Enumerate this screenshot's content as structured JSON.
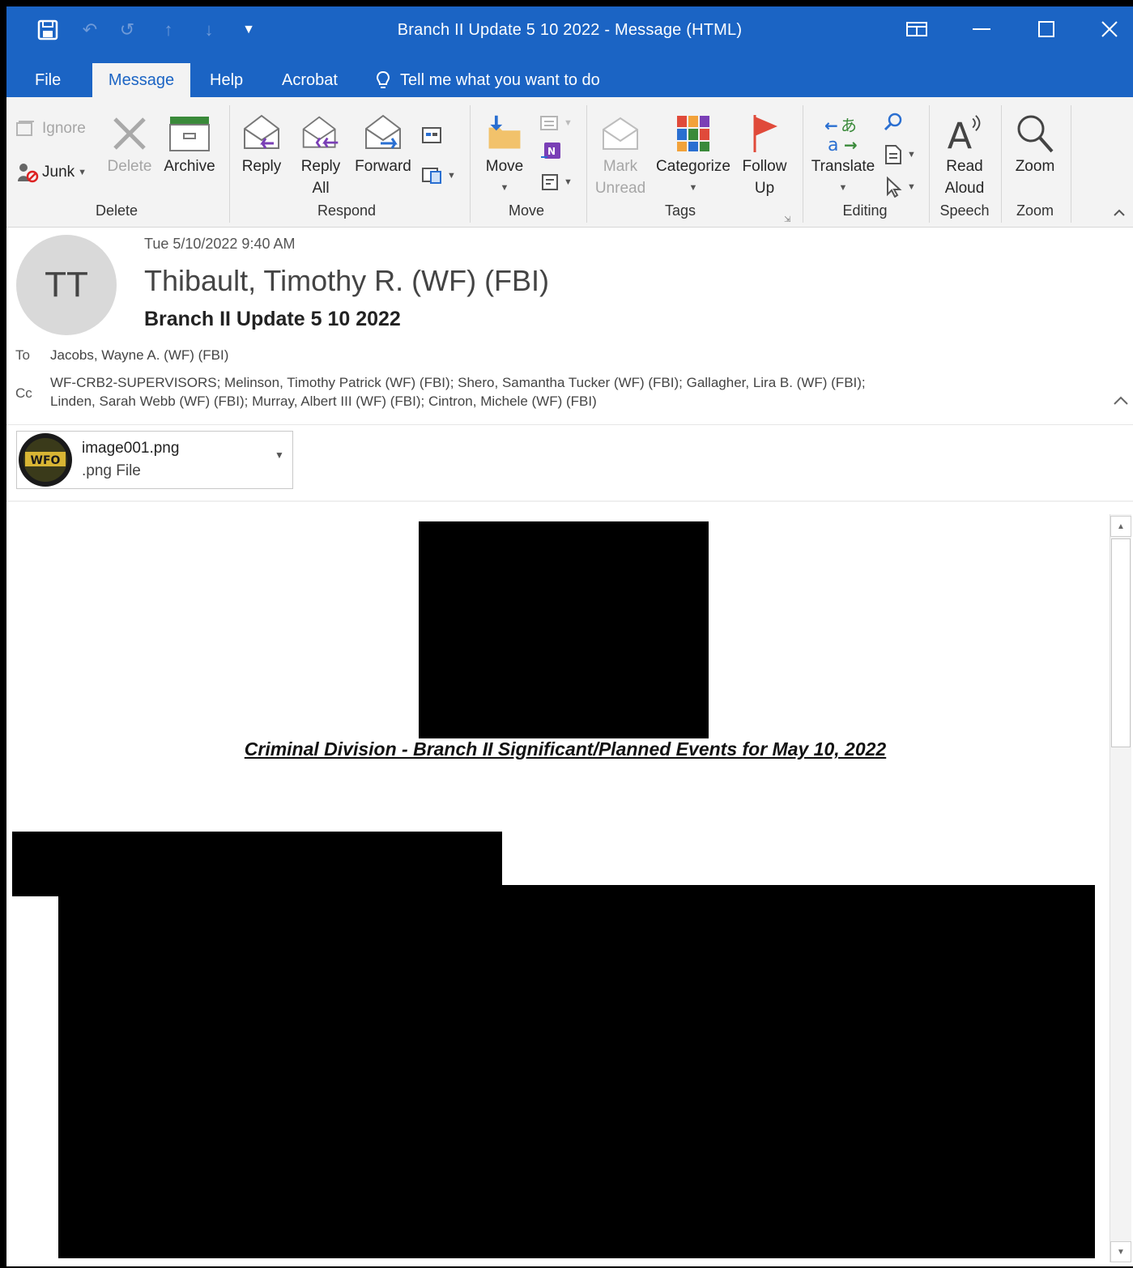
{
  "window": {
    "title": "Branch II Update 5 10 2022  -  Message (HTML)"
  },
  "tabs": [
    {
      "label": "File"
    },
    {
      "label": "Message"
    },
    {
      "label": "Help"
    },
    {
      "label": "Acrobat"
    }
  ],
  "tell_me": "Tell me what you want to do",
  "ribbon": {
    "delete": {
      "ignore": "Ignore",
      "junk": "Junk",
      "delete": "Delete",
      "archive": "Archive",
      "group": "Delete"
    },
    "respond": {
      "reply": "Reply",
      "reply_all_1": "Reply",
      "reply_all_2": "All",
      "forward": "Forward",
      "group": "Respond"
    },
    "move": {
      "move": "Move",
      "group": "Move"
    },
    "tags": {
      "mark_1": "Mark",
      "mark_2": "Unread",
      "categorize": "Categorize",
      "follow_1": "Follow",
      "follow_2": "Up",
      "group": "Tags"
    },
    "editing": {
      "translate": "Translate",
      "group": "Editing"
    },
    "speech": {
      "read_1": "Read",
      "read_2": "Aloud",
      "group": "Speech"
    },
    "zoom": {
      "zoom": "Zoom",
      "group": "Zoom"
    }
  },
  "message": {
    "avatar_initials": "TT",
    "date": "Tue 5/10/2022 9:40 AM",
    "sender": "Thibault, Timothy R. (WF) (FBI)",
    "subject": "Branch II Update 5 10 2022",
    "to_label": "To",
    "to": "Jacobs, Wayne A. (WF) (FBI)",
    "cc_label": "Cc",
    "cc_line1": "WF-CRB2-SUPERVISORS; Melinson, Timothy Patrick (WF) (FBI); Shero, Samantha Tucker (WF) (FBI); Gallagher, Lira B. (WF) (FBI);",
    "cc_line2": "Linden, Sarah Webb (WF) (FBI); Murray, Albert III (WF) (FBI); Cintron, Michele (WF) (FBI)"
  },
  "attachment": {
    "name": "image001.png",
    "type": ".png File",
    "logo_text": "WFO"
  },
  "body": {
    "headline": "Criminal Division - Branch II Significant/Planned Events for May 10, 2022"
  },
  "colors": {
    "title_bar": "#1b64c4",
    "ribbon": "#f3f3f3",
    "accent": "#1b64c4"
  }
}
